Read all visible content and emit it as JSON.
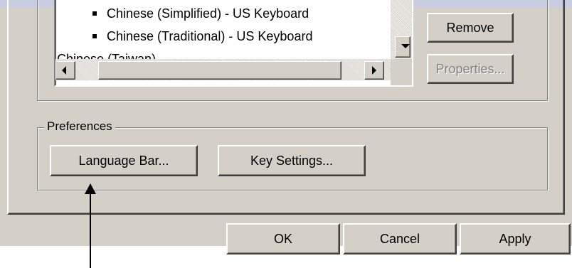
{
  "installed_services": {
    "list_items": [
      "Chinese (Simplified) - US Keyboard",
      "Chinese (Traditional) - US Keyboard",
      "Chinese (Taiwan)"
    ],
    "remove_label": "Remove",
    "properties_label": "Properties..."
  },
  "preferences": {
    "legend": "Preferences",
    "language_bar_label": "Language Bar...",
    "key_settings_label": "Key Settings..."
  },
  "dialog_buttons": {
    "ok_label": "OK",
    "cancel_label": "Cancel",
    "apply_label": "Apply"
  },
  "colors": {
    "dialog_face": "#d4d0c8",
    "title_strip": "#c9cde4",
    "disabled_text": "#808080"
  },
  "icons": [
    "scroll-down-arrow-icon",
    "scroll-left-arrow-icon",
    "scroll-right-arrow-icon",
    "annotation-arrow-icon"
  ]
}
